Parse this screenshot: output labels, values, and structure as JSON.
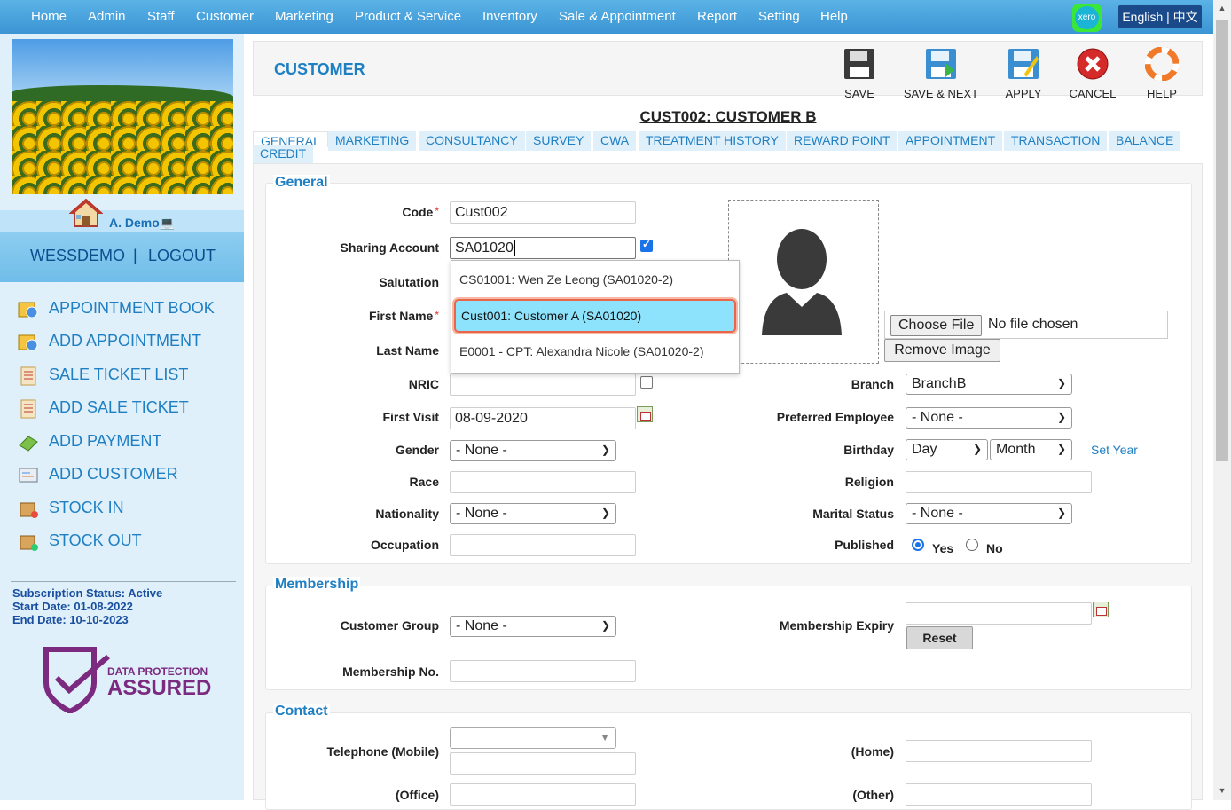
{
  "nav": {
    "items": [
      "Home",
      "Admin",
      "Staff",
      "Customer",
      "Marketing",
      "Product & Service",
      "Inventory",
      "Sale & Appointment",
      "Report",
      "Setting",
      "Help"
    ],
    "xero_label": "xero",
    "lang_label": "English | 中文"
  },
  "sidebar": {
    "username": "A. Demo💻",
    "account": "WESSDEMO",
    "divider": "|",
    "logout": "LOGOUT",
    "menu": [
      {
        "label": "APPOINTMENT BOOK",
        "icon": "calendar-clock-icon"
      },
      {
        "label": "ADD APPOINTMENT",
        "icon": "calendar-clock-icon"
      },
      {
        "label": "SALE TICKET LIST",
        "icon": "ticket-list-icon"
      },
      {
        "label": "ADD SALE TICKET",
        "icon": "ticket-list-icon"
      },
      {
        "label": "ADD PAYMENT",
        "icon": "money-icon"
      },
      {
        "label": "ADD CUSTOMER",
        "icon": "customer-card-icon"
      },
      {
        "label": "STOCK IN",
        "icon": "box-in-icon"
      },
      {
        "label": "STOCK OUT",
        "icon": "box-out-icon"
      }
    ],
    "subscription": {
      "status": "Subscription Status: Active",
      "start": "Start Date: 01-08-2022",
      "end": "End Date: 10-10-2023"
    },
    "badge": {
      "line1": "DATA PROTECTION",
      "line2": "ASSURED"
    }
  },
  "header": {
    "title": "CUSTOMER",
    "buttons": [
      {
        "label": "SAVE",
        "icon": "floppy-disk-icon"
      },
      {
        "label": "SAVE & NEXT",
        "icon": "save-next-icon"
      },
      {
        "label": "APPLY",
        "icon": "apply-icon"
      },
      {
        "label": "CANCEL",
        "icon": "cancel-icon"
      },
      {
        "label": "HELP",
        "icon": "lifebuoy-icon"
      }
    ]
  },
  "customer_title": "CUST002: CUSTOMER B",
  "tabs": [
    "GENERAL",
    "MARKETING",
    "CONSULTANCY",
    "SURVEY",
    "CWA",
    "TREATMENT HISTORY",
    "REWARD POINT",
    "APPOINTMENT",
    "TRANSACTION",
    "BALANCE",
    "CREDIT"
  ],
  "general": {
    "legend": "General",
    "code_label": "Code",
    "code_value": "Cust002",
    "sharing_label": "Sharing Account",
    "sharing_value": "SA01020",
    "salutation_label": "Salutation",
    "first_name_label": "First Name",
    "last_name_label": "Last Name",
    "nric_label": "NRIC",
    "first_visit_label": "First Visit",
    "first_visit_value": "08-09-2020",
    "gender_label": "Gender",
    "gender_value": "- None -",
    "race_label": "Race",
    "nationality_label": "Nationality",
    "nationality_value": "- None -",
    "occupation_label": "Occupation",
    "choose_file": "Choose File",
    "no_file": "No file chosen",
    "remove_image": "Remove Image",
    "branch_label": "Branch",
    "branch_value": "BranchB",
    "pref_emp_label": "Preferred Employee",
    "pref_emp_value": "- None -",
    "birthday_label": "Birthday",
    "day_value": "Day",
    "month_value": "Month",
    "set_year": "Set Year",
    "religion_label": "Religion",
    "marital_label": "Marital Status",
    "marital_value": "- None -",
    "published_label": "Published",
    "yes": "Yes",
    "no": "No"
  },
  "autocomplete": [
    "CS01001: Wen Ze Leong (SA01020-2)",
    "Cust001: Customer A (SA01020)",
    "E0001 - CPT: Alexandra Nicole (SA01020-2)"
  ],
  "membership": {
    "legend": "Membership",
    "group_label": "Customer Group",
    "group_value": "- None -",
    "no_label": "Membership No.",
    "expiry_label": "Membership Expiry",
    "reset": "Reset"
  },
  "contact": {
    "legend": "Contact",
    "mobile_label": "Telephone (Mobile)",
    "home_label": "(Home)",
    "office_label": "(Office)",
    "other_label": "(Other)"
  }
}
